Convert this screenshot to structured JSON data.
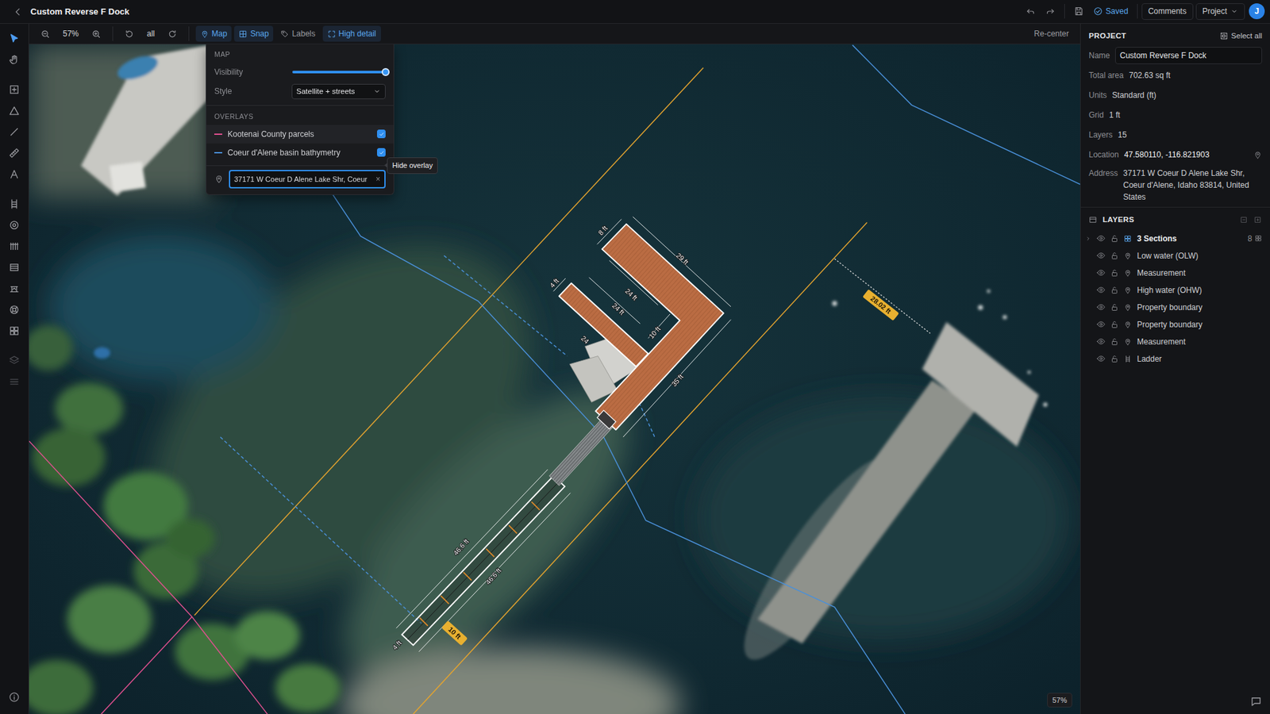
{
  "window": {
    "title": "Custom Reverse F Dock"
  },
  "topbar": {
    "status": "Saved",
    "comments": "Comments",
    "menu": "Project",
    "avatar": "J"
  },
  "rail": {
    "tools": [
      {
        "selected": true,
        "disabled": false
      },
      {
        "selected": false,
        "disabled": false
      },
      {
        "selected": false,
        "disabled": false
      },
      {
        "selected": false,
        "disabled": false
      },
      {
        "selected": false,
        "disabled": false
      },
      {
        "selected": false,
        "disabled": false
      },
      {
        "selected": false,
        "disabled": false
      },
      {
        "selected": false,
        "disabled": false
      },
      {
        "selected": false,
        "disabled": false
      },
      {
        "selected": false,
        "disabled": false
      },
      {
        "selected": false,
        "disabled": false
      },
      {
        "selected": false,
        "disabled": false
      },
      {
        "selected": false,
        "disabled": false
      },
      {
        "selected": false,
        "disabled": false
      },
      {
        "selected": false,
        "disabled": true
      },
      {
        "selected": false,
        "disabled": true
      }
    ]
  },
  "toolbar": {
    "zoom": "57%",
    "rotation": "all",
    "toggles": [
      {
        "label": "Map",
        "selected": true
      },
      {
        "label": "Snap",
        "selected": true
      },
      {
        "label": "Labels",
        "selected": false
      },
      {
        "label": "High detail",
        "selected": true
      }
    ],
    "recenter": "Re-center"
  },
  "map_panel": {
    "title": "MAP",
    "visibility_label": "Visibility",
    "visibility": {
      "level": 1.0
    },
    "style_label": "Style",
    "style": "Satellite + streets",
    "overlays_title": "OVERLAYS",
    "overlays": [
      {
        "label": "Kootenai County parcels",
        "checked": true,
        "hovered": true,
        "color": "#e0508f"
      },
      {
        "label": "Coeur d'Alene basin bathymetry",
        "checked": true,
        "hovered": false,
        "color": "#4a90d9"
      }
    ],
    "address": "37171 W Coeur D Alene Lake Shr, Coeur",
    "clear": "×"
  },
  "tooltip": {
    "text": "Hide overlay"
  },
  "canvas": {
    "labels": [
      {
        "text": "8 ft",
        "kind": "dimension"
      },
      {
        "text": "29 ft",
        "kind": "dimension"
      },
      {
        "text": "4 ft",
        "kind": "dimension"
      },
      {
        "text": "24 ft",
        "kind": "dimension"
      },
      {
        "text": "24 ft",
        "kind": "dimension"
      },
      {
        "text": "10 ft",
        "kind": "dimension"
      },
      {
        "text": "24",
        "kind": "dimension"
      },
      {
        "text": "35 ft",
        "kind": "dimension"
      },
      {
        "text": "46.6 ft",
        "kind": "dimension"
      },
      {
        "text": "46.6 ft",
        "kind": "dimension"
      },
      {
        "text": "4 ft",
        "kind": "dimension"
      },
      {
        "text": "10 ft",
        "kind": "tag"
      },
      {
        "text": "28.02 ft",
        "kind": "tag"
      }
    ],
    "zoom_badge": "57%"
  },
  "project": {
    "header": "PROJECT",
    "select_all": "Select all",
    "fields": [
      {
        "label": "Name",
        "value": "Custom Reverse F Dock",
        "kind": "input"
      },
      {
        "label": "Total area",
        "value": "702.63 sq ft",
        "kind": "text"
      },
      {
        "label": "Units",
        "value": "Standard (ft)",
        "kind": "text"
      },
      {
        "label": "Grid",
        "value": "1 ft",
        "kind": "text"
      },
      {
        "label": "Layers",
        "value": "15",
        "kind": "text"
      },
      {
        "label": "Location",
        "value": "47.580110, -116.821903",
        "kind": "location"
      },
      {
        "label": "Address",
        "value": "37171 W Coeur D Alene Lake Shr, Coeur d'Alene, Idaho 83814, United States",
        "kind": "text"
      }
    ]
  },
  "layers": {
    "header": "LAYERS",
    "items": [
      {
        "name": "3 Sections",
        "count": "8",
        "kind": "group",
        "expanded": false,
        "visible": true
      },
      {
        "name": "Low water (OLW)",
        "kind": "marker",
        "visible": true
      },
      {
        "name": "Measurement",
        "kind": "marker",
        "visible": true
      },
      {
        "name": "High water (OHW)",
        "kind": "marker",
        "visible": true
      },
      {
        "name": "Property boundary",
        "kind": "marker",
        "visible": true
      },
      {
        "name": "Property boundary",
        "kind": "marker",
        "visible": true
      },
      {
        "name": "Measurement",
        "kind": "marker",
        "visible": true
      },
      {
        "name": "Ladder",
        "kind": "ladder",
        "visible": true
      }
    ]
  }
}
